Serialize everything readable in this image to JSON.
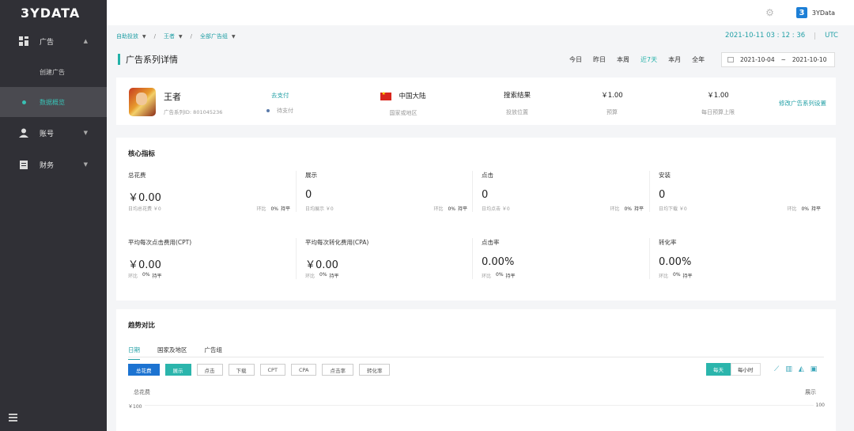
{
  "sidebar": {
    "logo": "3YDATA",
    "items": [
      {
        "label": "广告",
        "arrow": "▲"
      },
      {
        "label": "账号",
        "arrow": "▼"
      },
      {
        "label": "财务",
        "arrow": "▼"
      }
    ],
    "sub_items": [
      {
        "label": "创建广告"
      },
      {
        "label": "数据概览"
      }
    ]
  },
  "topbar": {
    "user": "3YData",
    "user_logo": "3"
  },
  "breadcrumb": [
    {
      "label": "自助投放",
      "caret": "▼"
    },
    {
      "label": "王者",
      "caret": "▼"
    },
    {
      "label": "全部广告组",
      "caret": "▼"
    }
  ],
  "breadcrumb_sep": "/",
  "datetime": {
    "value": "2021-10-11 03 : 12 : 36",
    "tz": "UTC"
  },
  "page_title": "广告系列详情",
  "ranges": [
    "今日",
    "昨日",
    "本周",
    "近7天",
    "本月",
    "全年"
  ],
  "date_range": {
    "start": "2021-10-04",
    "sep": "~",
    "end": "2021-10-10"
  },
  "campaign": {
    "name": "王者",
    "id_text": "广告系列ID: 801045236",
    "pay_link": "去支付",
    "pay_status": "待支付",
    "region": "中国大陆",
    "region_label": "国家或地区",
    "placement": "搜索结果",
    "placement_label": "投放位置",
    "budget": "￥1.00",
    "budget_label": "预算",
    "daily_budget": "￥1.00",
    "daily_budget_label": "每日预算上限",
    "modify": "修改广告系列设置"
  },
  "metrics_title": "核心指标",
  "metrics": [
    {
      "title": "总花费",
      "value": "￥0.00",
      "daily": "日均总花费  ￥0",
      "cmp": "环比",
      "pct": "0%",
      "flat": "持平"
    },
    {
      "title": "展示",
      "value": "0",
      "daily": "日均展示  ￥0",
      "cmp": "环比",
      "pct": "0%",
      "flat": "持平"
    },
    {
      "title": "点击",
      "value": "0",
      "daily": "日均点击  ￥0",
      "cmp": "环比",
      "pct": "0%",
      "flat": "持平"
    },
    {
      "title": "安装",
      "value": "0",
      "daily": "日均下载  ￥0",
      "cmp": "环比",
      "pct": "0%",
      "flat": "持平"
    },
    {
      "title": "平均每次点击费用(CPT)",
      "value": "￥0.00",
      "daily": "",
      "cmp": "环比",
      "pct": "0%",
      "flat": "持平"
    },
    {
      "title": "平均每次转化费用(CPA)",
      "value": "￥0.00",
      "daily": "",
      "cmp": "环比",
      "pct": "0%",
      "flat": "持平"
    },
    {
      "title": "点击率",
      "value": "0.00%",
      "daily": "",
      "cmp": "环比",
      "pct": "0%",
      "flat": "持平"
    },
    {
      "title": "转化率",
      "value": "0.00%",
      "daily": "",
      "cmp": "环比",
      "pct": "0%",
      "flat": "持平"
    }
  ],
  "trend": {
    "title": "趋势对比",
    "tabs": [
      "日期",
      "国家及地区",
      "广告组"
    ],
    "buttons": [
      "总花费",
      "展示",
      "点击",
      "下载",
      "CPT",
      "CPA",
      "点击率",
      "转化率"
    ],
    "toggle": [
      "每天",
      "每小时"
    ],
    "left_axis": "总花费",
    "right_axis": "展示",
    "left_tick": "￥100",
    "right_tick": "100"
  }
}
